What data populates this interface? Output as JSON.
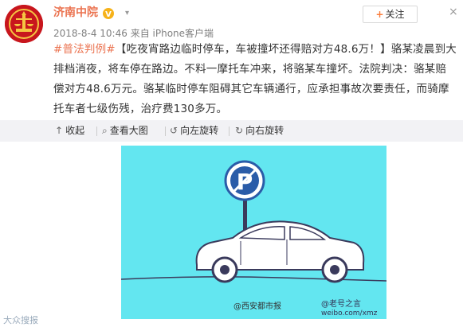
{
  "post": {
    "username": "济南中院",
    "follow_label": "关注",
    "close_glyph": "×",
    "timestamp": "2018-8-4 10:46",
    "source": "来自 iPhone客户端",
    "tag": "#普法判例#",
    "body": "【吃夜宵路边临时停车，车被撞坏还得赔对方48.6万！】骆某凌晨到大排档消夜，将车停在路边。不料一摩托车冲来，将骆某车撞坏。法院判决：骆某赔偿对方48.6万元。骆某临时停车阻碍其它车辆通行，应承担事故次要责任，而骑摩托车者七级伤残，治疗费130多万。"
  },
  "toolbar": {
    "collapse": "收起",
    "view_large": "查看大图",
    "rotate_left": "向左旋转",
    "rotate_right": "向右旋转"
  },
  "image": {
    "sign_letter": "P",
    "watermark_center": "@西安都市报",
    "watermark_right": "@老号之言",
    "watermark_right2": "weibo.com/xmz",
    "watermark_left": "大众搜报"
  },
  "colors": {
    "accent": "#eb7350",
    "cartoon_bg": "#63e6f0",
    "badge": "#c8161d",
    "toolbar_bg": "#f2f2f5"
  }
}
